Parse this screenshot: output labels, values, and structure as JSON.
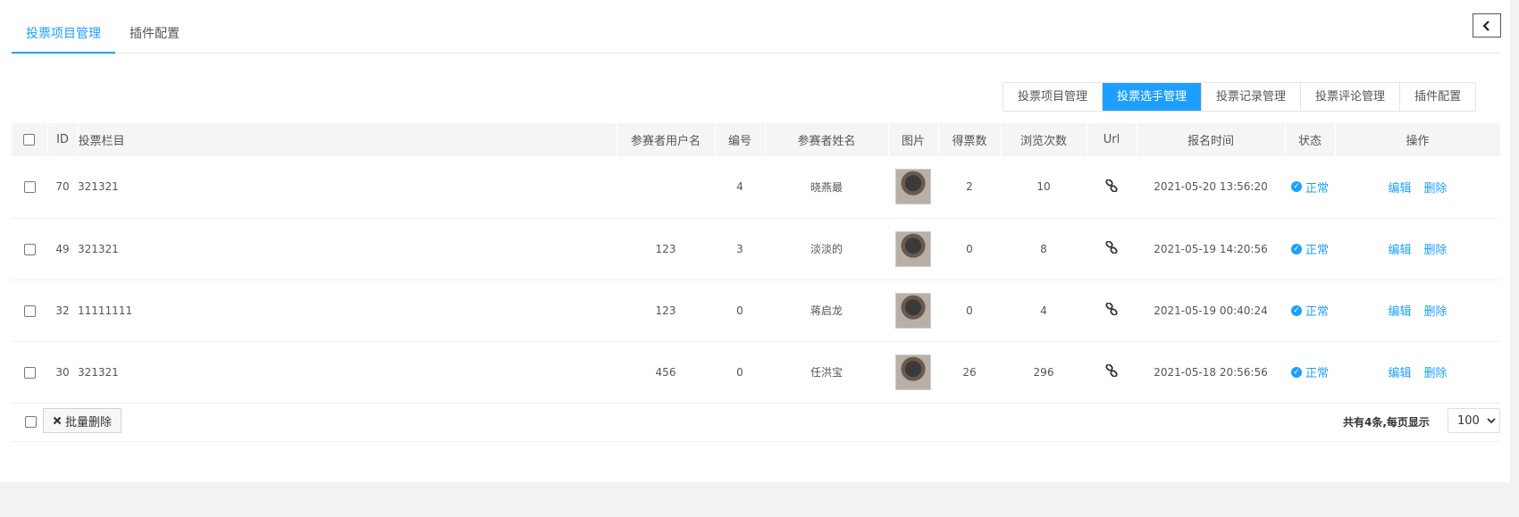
{
  "top_tabs": [
    {
      "label": "投票项目管理",
      "active": true
    },
    {
      "label": "插件配置",
      "active": false
    }
  ],
  "sub_tabs": [
    {
      "label": "投票项目管理",
      "active": false
    },
    {
      "label": "投票选手管理",
      "active": true
    },
    {
      "label": "投票记录管理",
      "active": false
    },
    {
      "label": "投票评论管理",
      "active": false
    },
    {
      "label": "插件配置",
      "active": false
    }
  ],
  "table": {
    "headers": {
      "id": "ID",
      "column": "投票栏目",
      "username": "参赛者用户名",
      "number": "编号",
      "name": "参赛者姓名",
      "image": "图片",
      "votes": "得票数",
      "views": "浏览次数",
      "url": "Url",
      "time": "报名时间",
      "status": "状态",
      "ops": "操作"
    },
    "rows": [
      {
        "id": "70",
        "column": "321321",
        "username": "",
        "number": "4",
        "name": "晓燕最",
        "votes": "2",
        "views": "10",
        "time": "2021-05-20 13:56:20",
        "status": "正常"
      },
      {
        "id": "49",
        "column": "321321",
        "username": "123",
        "number": "3",
        "name": "淡淡的",
        "votes": "0",
        "views": "8",
        "time": "2021-05-19 14:20:56",
        "status": "正常"
      },
      {
        "id": "32",
        "column": "11111111",
        "username": "123",
        "number": "0",
        "name": "蒋启龙",
        "votes": "0",
        "views": "4",
        "time": "2021-05-19 00:40:24",
        "status": "正常"
      },
      {
        "id": "30",
        "column": "321321",
        "username": "456",
        "number": "0",
        "name": "任洪宝",
        "votes": "26",
        "views": "296",
        "time": "2021-05-18 20:56:56",
        "status": "正常"
      }
    ],
    "edit_label": "编辑",
    "delete_label": "删除"
  },
  "footer": {
    "batch_delete_label": "批量删除",
    "total_text": "共有4条,每页显示",
    "page_size": "100"
  },
  "colors": {
    "accent": "#1e9fff"
  },
  "icons": {
    "collapse": "chevron-left-icon",
    "url": "link-icon",
    "status": "check-circle-icon",
    "batch": "close-icon"
  }
}
